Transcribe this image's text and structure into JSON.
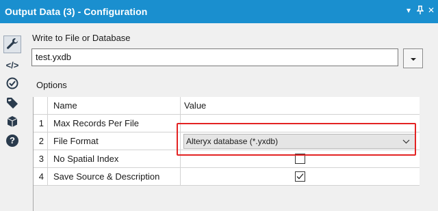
{
  "window": {
    "title": "Output Data (3) - Configuration",
    "controls": [
      "▾",
      "⊥",
      "✕"
    ]
  },
  "toolstrip": {
    "tools": [
      {
        "icon": "wrench-icon",
        "active": true
      },
      {
        "icon": "code-icon",
        "active": false
      },
      {
        "icon": "target-icon",
        "active": false
      },
      {
        "icon": "tag-icon",
        "active": false
      },
      {
        "icon": "cube-icon",
        "active": false
      },
      {
        "icon": "help-icon",
        "active": false
      }
    ],
    "code_glyph": "</>",
    "help_glyph": "?"
  },
  "write_to": {
    "label": "Write to File or Database",
    "value": "test.yxdb"
  },
  "options": {
    "label": "Options",
    "columns": [
      "Name",
      "Value"
    ],
    "rows": [
      {
        "num": "1",
        "name": "Max Records Per File",
        "value": ""
      },
      {
        "num": "2",
        "name": "File Format",
        "value": "Alteryx database (*.yxdb)"
      },
      {
        "num": "3",
        "name": "No Spatial Index",
        "checked": false
      },
      {
        "num": "4",
        "name": "Save Source & Description",
        "checked": true
      }
    ]
  },
  "colors": {
    "titlebar": "#1a8fcf",
    "highlight": "#e32222"
  }
}
